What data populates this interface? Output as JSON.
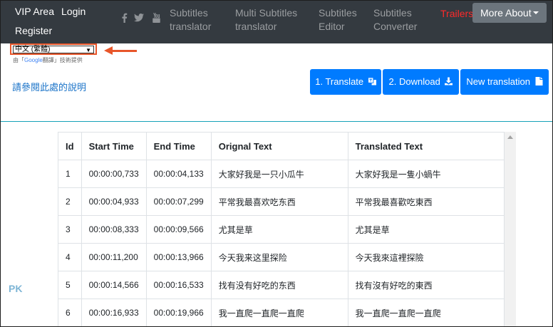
{
  "nav": {
    "vip_area": "VIP Area",
    "login": "Login",
    "register": "Register",
    "subtitles_translator": [
      "Subtitles",
      "translator"
    ],
    "multi_subtitles_translator": [
      "Multi Subtitles",
      "translator"
    ],
    "subtitles_editor": [
      "Subtitles",
      "Editor"
    ],
    "subtitles_converter": [
      "Subtitles",
      "Converter"
    ],
    "trailers": "Trailers",
    "more_about": "More About"
  },
  "social_icons": [
    "facebook-icon",
    "twitter-icon",
    "youtube-icon"
  ],
  "language": {
    "selected": "中文 (繁體)",
    "credit_prefix": "由「",
    "credit_brand": "Google",
    "credit_suffix": "翻譯」技術提供"
  },
  "help_link": "請參閱此處的說明",
  "buttons": {
    "translate": "1. Translate",
    "download": "2. Download",
    "new_translation": "New translation"
  },
  "table": {
    "headers": [
      "Id",
      "Start Time",
      "End Time",
      "Orignal Text",
      "Translated Text"
    ],
    "rows": [
      [
        "1",
        "00:00:00,733",
        "00:00:04,133",
        "大家好我是一只小瓜牛",
        "大家好我是一隻小蝸牛"
      ],
      [
        "2",
        "00:00:04,933",
        "00:00:07,299",
        "平常我最喜欢吃东西",
        "平常我最喜歡吃東西"
      ],
      [
        "3",
        "00:00:08,333",
        "00:00:09,566",
        "尤其是草",
        "尤其是草"
      ],
      [
        "4",
        "00:00:11,200",
        "00:00:13,966",
        "今天我来这里探险",
        "今天我來這裡探險"
      ],
      [
        "5",
        "00:00:14,566",
        "00:00:16,533",
        "找有没有好吃的东西",
        "找有沒有好吃的東西"
      ],
      [
        "6",
        "00:00:16,933",
        "00:00:19,966",
        "我一直爬一直爬一直爬",
        "我一直爬一直爬一直爬"
      ]
    ]
  },
  "watermark": "PK",
  "colors": {
    "navbar": "#343a40",
    "primary": "#007bff",
    "trailers": "#ff2a2a",
    "highlight": "#e8562a",
    "divider": "#17a2b8"
  }
}
